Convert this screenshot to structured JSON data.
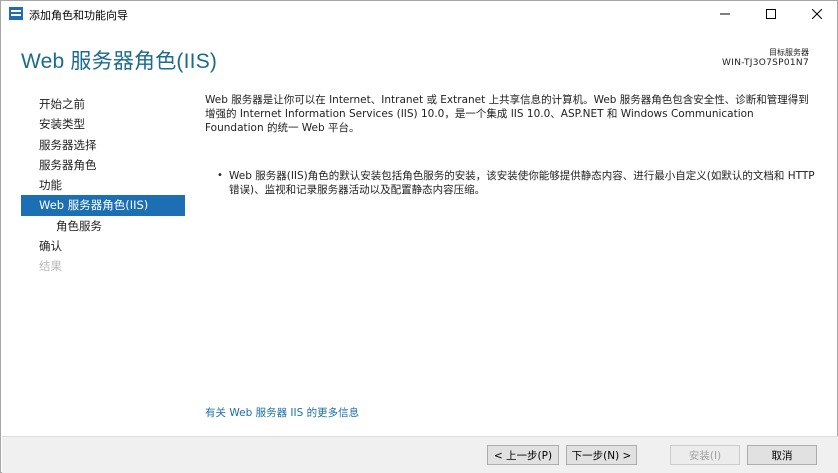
{
  "window": {
    "title": "添加角色和功能向导"
  },
  "header": {
    "page_title": "Web 服务器角色(IIS)",
    "destination_label": "目标服务器",
    "destination_server": "WIN-TJ3O7SP01N7"
  },
  "nav": {
    "items": [
      {
        "label": "开始之前",
        "state": "normal"
      },
      {
        "label": "安装类型",
        "state": "normal"
      },
      {
        "label": "服务器选择",
        "state": "normal"
      },
      {
        "label": "服务器角色",
        "state": "normal"
      },
      {
        "label": "功能",
        "state": "normal"
      },
      {
        "label": "Web 服务器角色(IIS)",
        "state": "selected"
      },
      {
        "label": "角色服务",
        "state": "sub"
      },
      {
        "label": "确认",
        "state": "normal"
      },
      {
        "label": "结果",
        "state": "disabled"
      }
    ]
  },
  "content": {
    "description": "Web 服务器是让你可以在 Internet、Intranet 或 Extranet 上共享信息的计算机。Web 服务器角色包含安全性、诊断和管理得到增强的 Internet Information Services (IIS) 10.0，是一个集成 IIS 10.0、ASP.NET 和 Windows Communication Foundation 的统一 Web 平台。",
    "bullet": "Web 服务器(IIS)角色的默认安装包括角色服务的安装，该安装使你能够提供静态内容、进行最小自定义(如默认的文档和 HTTP 错误)、监视和记录服务器活动以及配置静态内容压缩。",
    "more_info_link": "有关 Web 服务器 IIS 的更多信息"
  },
  "footer": {
    "prev_label": "< 上一步(P)",
    "next_label": "下一步(N) >",
    "install_label": "安装(I)",
    "cancel_label": "取消"
  },
  "colors": {
    "accent": "#1c6fb3",
    "title": "#1b6b8f",
    "link": "#1a6fa6"
  }
}
